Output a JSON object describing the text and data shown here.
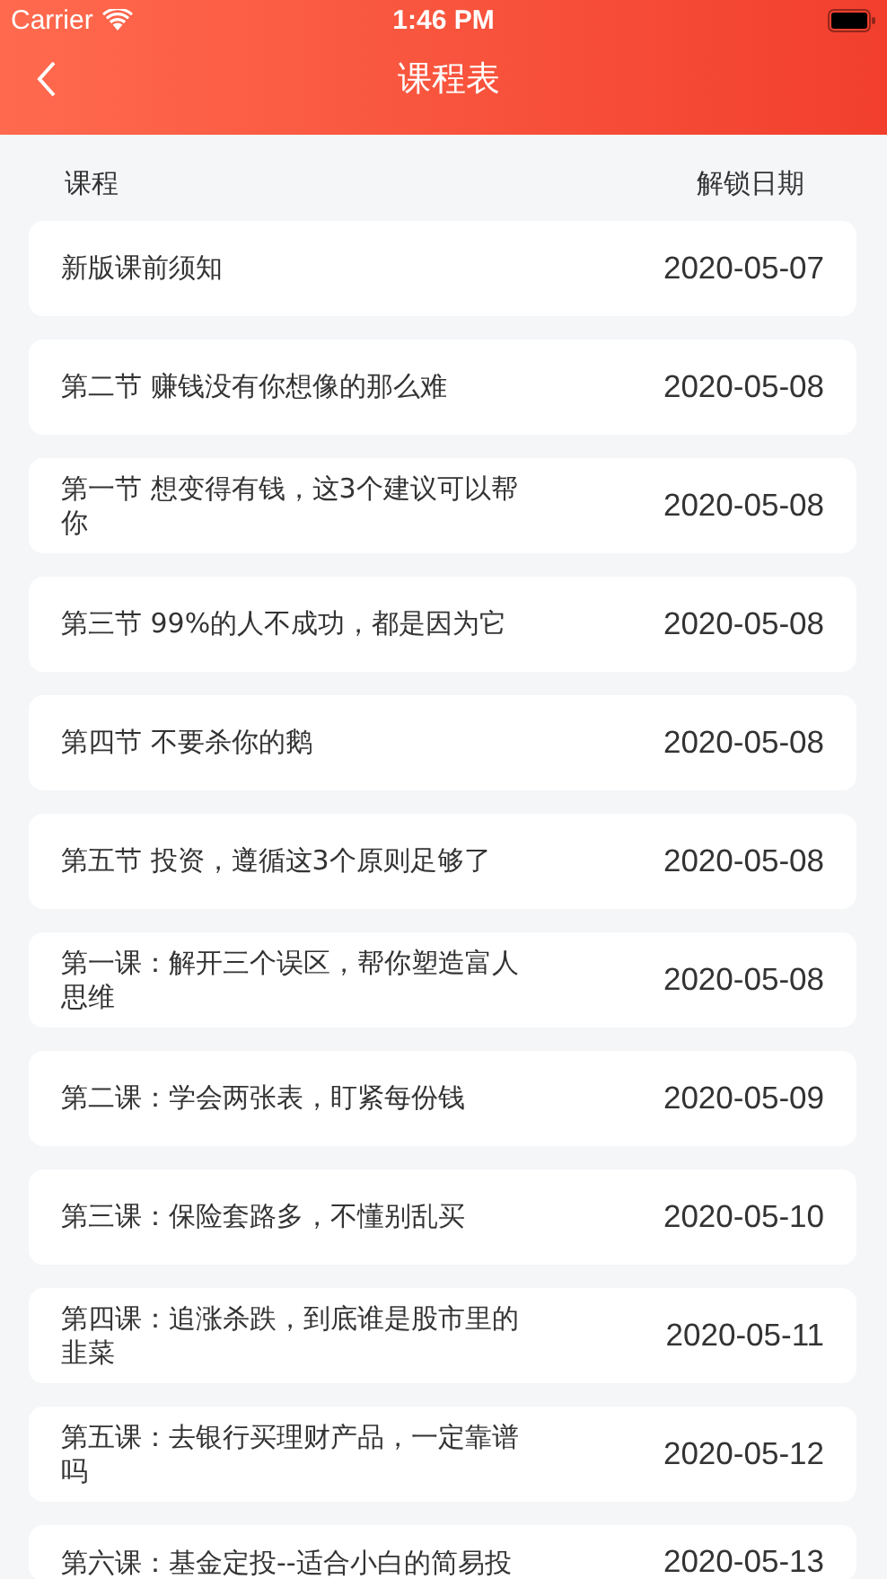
{
  "status_bar": {
    "carrier": "Carrier",
    "time": "1:46 PM"
  },
  "nav": {
    "title": "课程表"
  },
  "columns": [
    "课程",
    "解锁日期"
  ],
  "rows": [
    {
      "title": "新版课前须知",
      "date": "2020-05-07"
    },
    {
      "title": "第二节 赚钱没有你想像的那么难",
      "date": "2020-05-08"
    },
    {
      "title": "第一节 想变得有钱，这3个建议可以帮你",
      "date": "2020-05-08"
    },
    {
      "title": "第三节 99%的人不成功，都是因为它",
      "date": "2020-05-08"
    },
    {
      "title": "第四节 不要杀你的鹅",
      "date": "2020-05-08"
    },
    {
      "title": "第五节 投资，遵循这3个原则足够了",
      "date": "2020-05-08"
    },
    {
      "title": "第一课：解开三个误区，帮你塑造富人思维",
      "date": "2020-05-08"
    },
    {
      "title": "第二课：学会两张表，盯紧每份钱",
      "date": "2020-05-09"
    },
    {
      "title": "第三课：保险套路多，不懂别乱买",
      "date": "2020-05-10"
    },
    {
      "title": "第四课：追涨杀跌，到底谁是股市里的韭菜",
      "date": "2020-05-11"
    },
    {
      "title": "第五课：去银行买理财产品，一定靠谱吗",
      "date": "2020-05-12"
    },
    {
      "title": "第六课：基金定投--适合小白的简易投",
      "date": "2020-05-13",
      "partial": true
    }
  ]
}
